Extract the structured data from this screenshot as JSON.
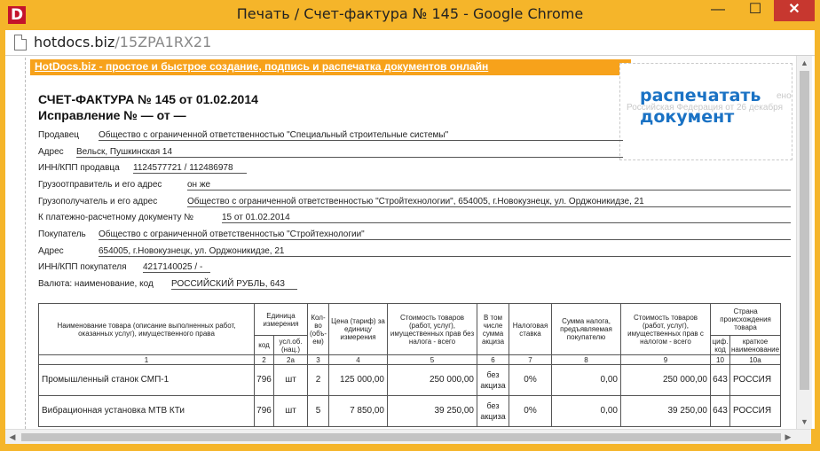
{
  "window": {
    "title": "Печать / Счет-фактура № 145 - Google Chrome",
    "app_icon_letter": "D",
    "minimize": "—",
    "maximize": "☐",
    "close": "✕"
  },
  "address": {
    "host": "hotdocs.biz",
    "path": "/15ZPA1RX21"
  },
  "promo_link": "HotDocs.biz - простое и быстрое создание, подпись и распечатка документов онлайн",
  "print_button": {
    "line1": "распечатать",
    "line2": "документ"
  },
  "ghost_text": {
    "line1": "ено",
    "line2": "Российская Федерация от 26 декабря"
  },
  "invoice": {
    "title": "СЧЕТ-ФАКТУРА № 145 от 01.02.2014",
    "correction": "Исправление № — от —",
    "seller_label": "Продавец",
    "seller": "Общество с ограниченной ответственностью \"Специальный строительные системы\"",
    "seller_address_label": "Адрес",
    "seller_address": "Вельск, Пушкинская 14",
    "seller_inn_label": "ИНН/КПП продавца",
    "seller_inn": "1124577721 / 112486978",
    "shipper_label": "Грузоотправитель и его адрес",
    "shipper": "он же",
    "consignee_label": "Грузополучатель и его адрес",
    "consignee": "Общество с ограниченной ответственностью \"Стройтехнологии\", 654005, г.Новокузнецк, ул. Орджоникидзе, 21",
    "payment_doc_label": "К платежно-расчетному документу №",
    "payment_doc": "15 от 01.02.2014",
    "buyer_label": "Покупатель",
    "buyer": "Общество с ограниченной ответственностью \"Стройтехнологии\"",
    "buyer_address_label": "Адрес",
    "buyer_address": "654005, г.Новокузнецк, ул. Орджоникидзе, 21",
    "buyer_inn_label": "ИНН/КПП покупателя",
    "buyer_inn": "4217140025 / -",
    "currency_label": "Валюта: наименование, код",
    "currency": "РОССИЙСКИЙ РУБЛЬ, 643"
  },
  "table": {
    "headers": {
      "name": "Наименование товара (описание выполненных работ, оказанных услуг), имущественного права",
      "unit": "Единица измерения",
      "qty": "Кол-во (объ-ем)",
      "price": "Цена (тариф) за единицу измерения",
      "cost_no_tax": "Стоимость товаров (работ, услуг), имущественных прав без налога - всего",
      "excise": "В том числе сумма акциза",
      "tax_rate": "Налоговая ставка",
      "tax_sum": "Сумма налога, предъявляемая покупателю",
      "cost_with_tax": "Стоимость товаров (работ, услуг), имущественных прав с налогом - всего",
      "country": "Страна происхождения товара",
      "unit_code": "код",
      "unit_name": "усл.об. (нац.)",
      "country_code": "циф. код",
      "country_name": "краткое наименование"
    },
    "numbers": [
      "1",
      "2",
      "2а",
      "3",
      "4",
      "5",
      "6",
      "7",
      "8",
      "9",
      "10",
      "10а"
    ],
    "rows": [
      {
        "name": "Промышленный станок СМП-1",
        "code": "796",
        "unit": "шт",
        "qty": "2",
        "price": "125 000,00",
        "cost": "250 000,00",
        "excise": "без акциза",
        "rate": "0%",
        "tax": "0,00",
        "total": "250 000,00",
        "ccode": "643",
        "country": "РОССИЯ"
      },
      {
        "name": "Вибрационная установка МТВ КТи",
        "code": "796",
        "unit": "шт",
        "qty": "5",
        "price": "7 850,00",
        "cost": "39 250,00",
        "excise": "без акциза",
        "rate": "0%",
        "tax": "0,00",
        "total": "39 250,00",
        "ccode": "643",
        "country": "РОССИЯ"
      }
    ]
  },
  "colors": {
    "chrome_frame": "#f5b52a",
    "promo_bg": "#f7a21b",
    "print_link": "#1a72c4",
    "close_button": "#c7372f"
  }
}
